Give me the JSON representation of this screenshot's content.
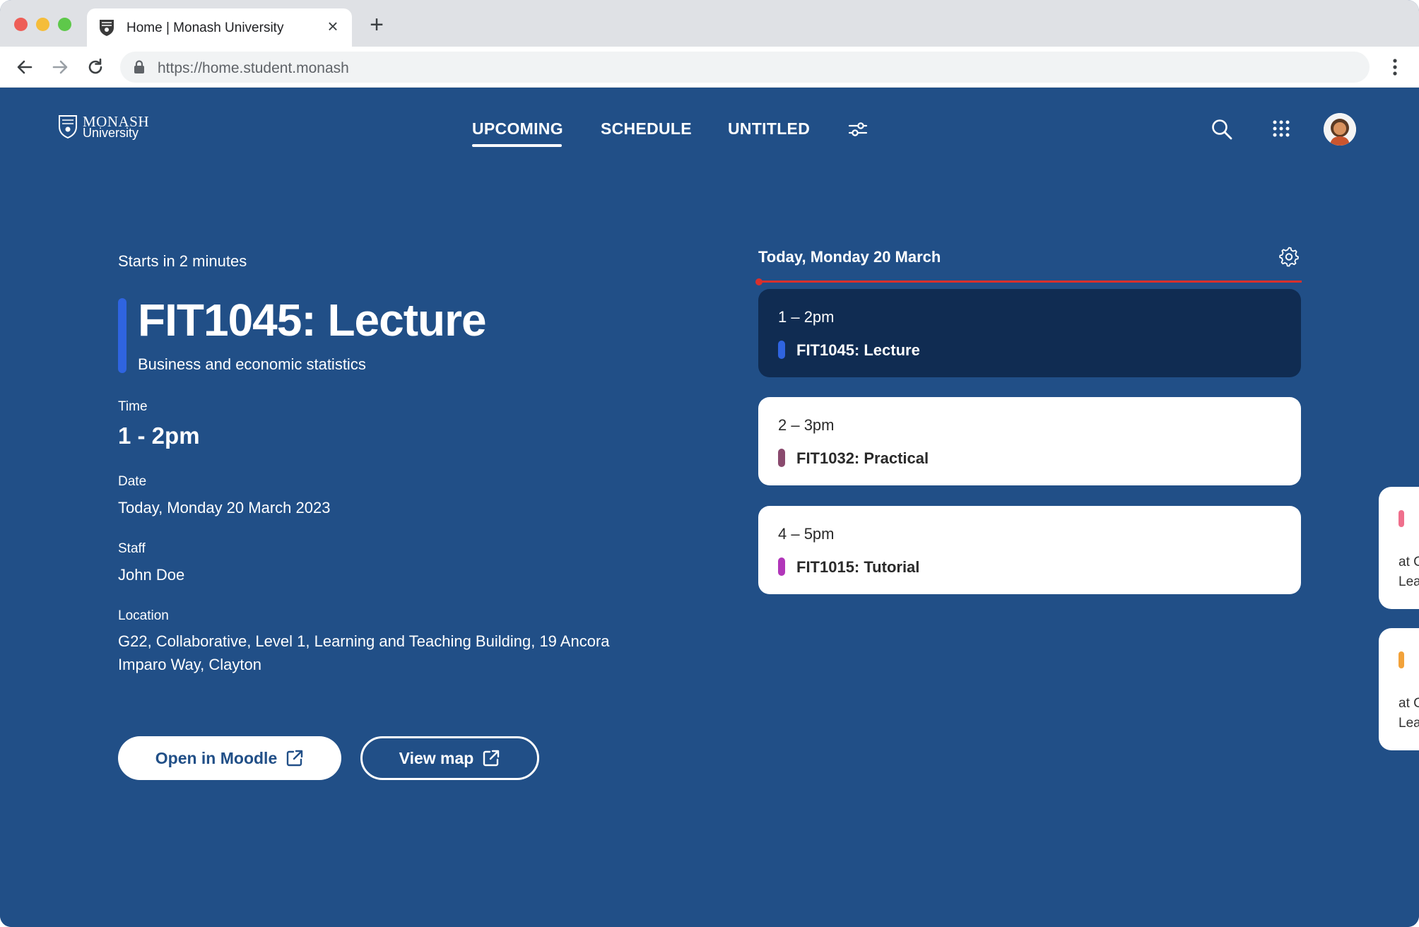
{
  "browser": {
    "tab_title": "Home | Monash University",
    "url": "https://home.student.monash"
  },
  "header": {
    "logo_line1": "MONASH",
    "logo_line2": "University",
    "nav": [
      "UPCOMING",
      "SCHEDULE",
      "UNTITLED"
    ],
    "active_nav": "UPCOMING"
  },
  "upcoming": {
    "starts_in": "Starts in 2 minutes",
    "title": "FIT1045: Lecture",
    "subtitle": "Business and economic statistics",
    "accent_color": "#2f64e0",
    "time_label": "Time",
    "time_value": "1 - 2pm",
    "date_label": "Date",
    "date_value": "Today, Monday 20 March 2023",
    "staff_label": "Staff",
    "staff_value": "John Doe",
    "location_label": "Location",
    "location_value": "G22, Collaborative, Level 1, Learning and Teaching Building, 19 Ancora Imparo Way, Clayton",
    "buttons": {
      "moodle": "Open in Moodle",
      "map": "View map"
    }
  },
  "schedule": {
    "day_header": "Today, Monday 20 March",
    "events": [
      {
        "time": "1 – 2pm",
        "name": "FIT1045: Lecture",
        "color": "#2f64e0",
        "active": true
      },
      {
        "time": "2 – 3pm",
        "name": "FIT1032: Practical",
        "color": "#8a4a6e",
        "active": false
      },
      {
        "time": "4 – 5pm",
        "name": "FIT1015: Tutorial",
        "color": "#b136b9",
        "active": false
      }
    ]
  },
  "side_cards": [
    {
      "color": "#ef6f8c",
      "line1": "at C",
      "line2": "Lea"
    },
    {
      "color": "#f2a23a",
      "line1": "at C",
      "line2": "Lea"
    }
  ],
  "colors": {
    "background": "#214f87",
    "active_card": "#102c52",
    "now_line": "#d8302c"
  }
}
